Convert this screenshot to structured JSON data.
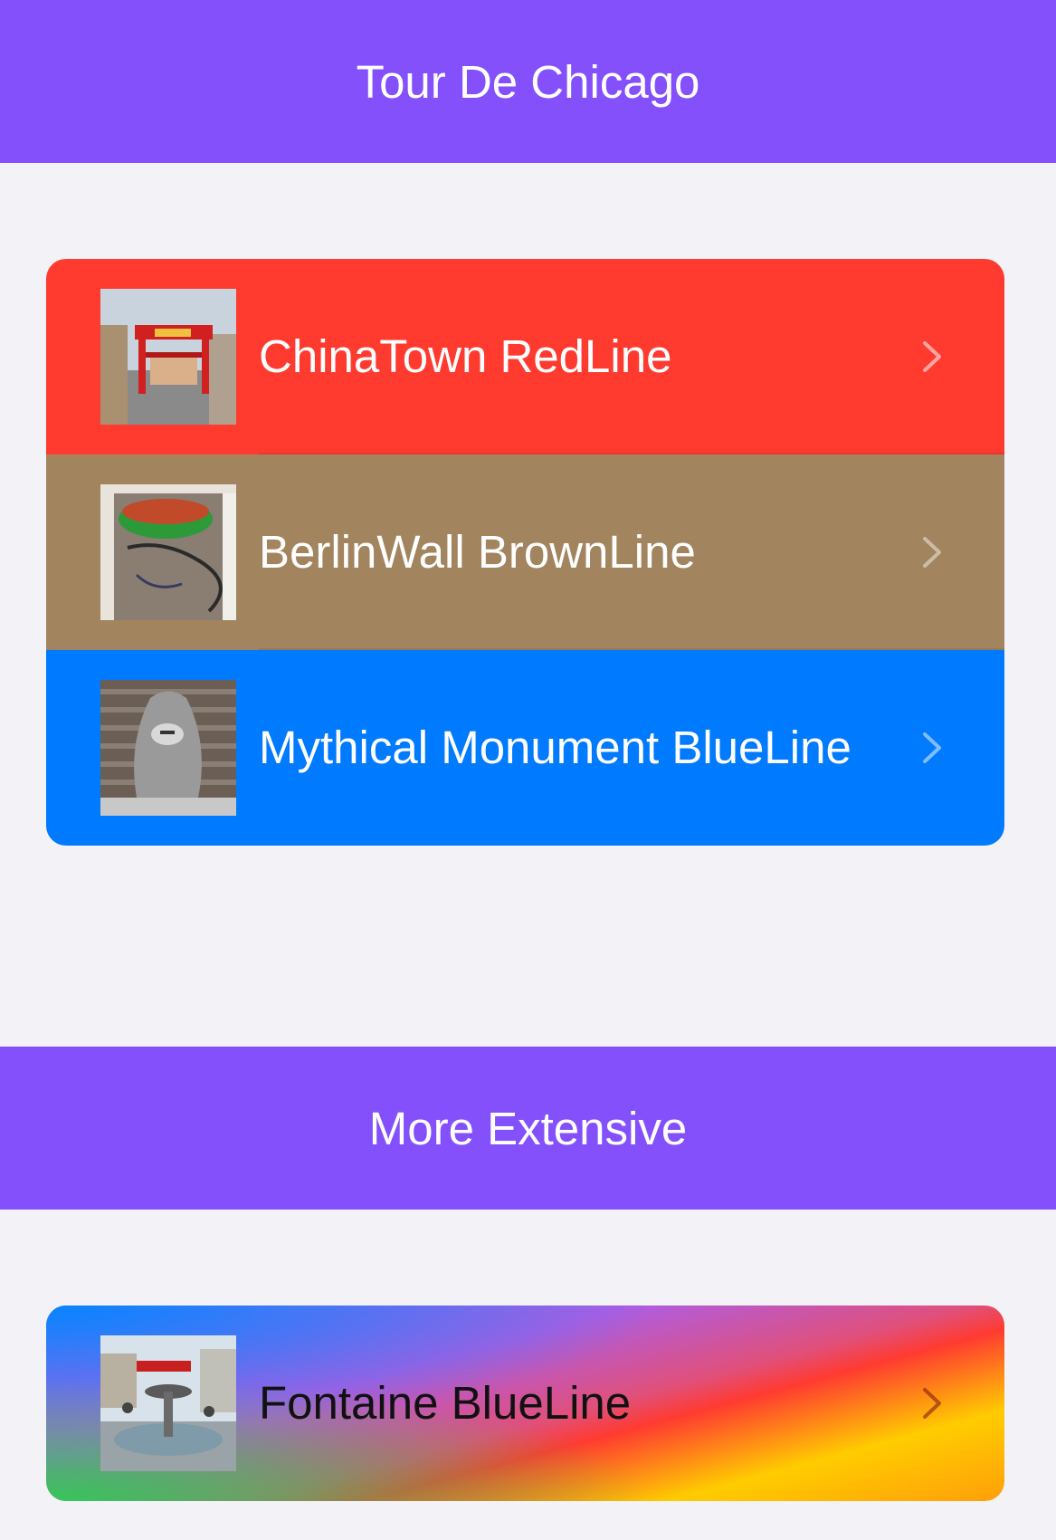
{
  "header": {
    "title": "Tour De Chicago"
  },
  "section1": {
    "rows": [
      {
        "label": "ChinaTown RedLine",
        "color": "#ff3b30",
        "icon": "chevron-right-icon"
      },
      {
        "label": "BerlinWall BrownLine",
        "color": "#a2845e",
        "icon": "chevron-right-icon"
      },
      {
        "label": "Mythical Monument BlueLine",
        "color": "#007aff",
        "icon": "chevron-right-icon"
      }
    ]
  },
  "section2": {
    "title": "More Extensive",
    "rows": [
      {
        "label": "Fontaine BlueLine",
        "icon": "chevron-right-icon"
      }
    ]
  },
  "colors": {
    "header_bg": "#8450fc",
    "page_bg": "#f2f2f7"
  }
}
